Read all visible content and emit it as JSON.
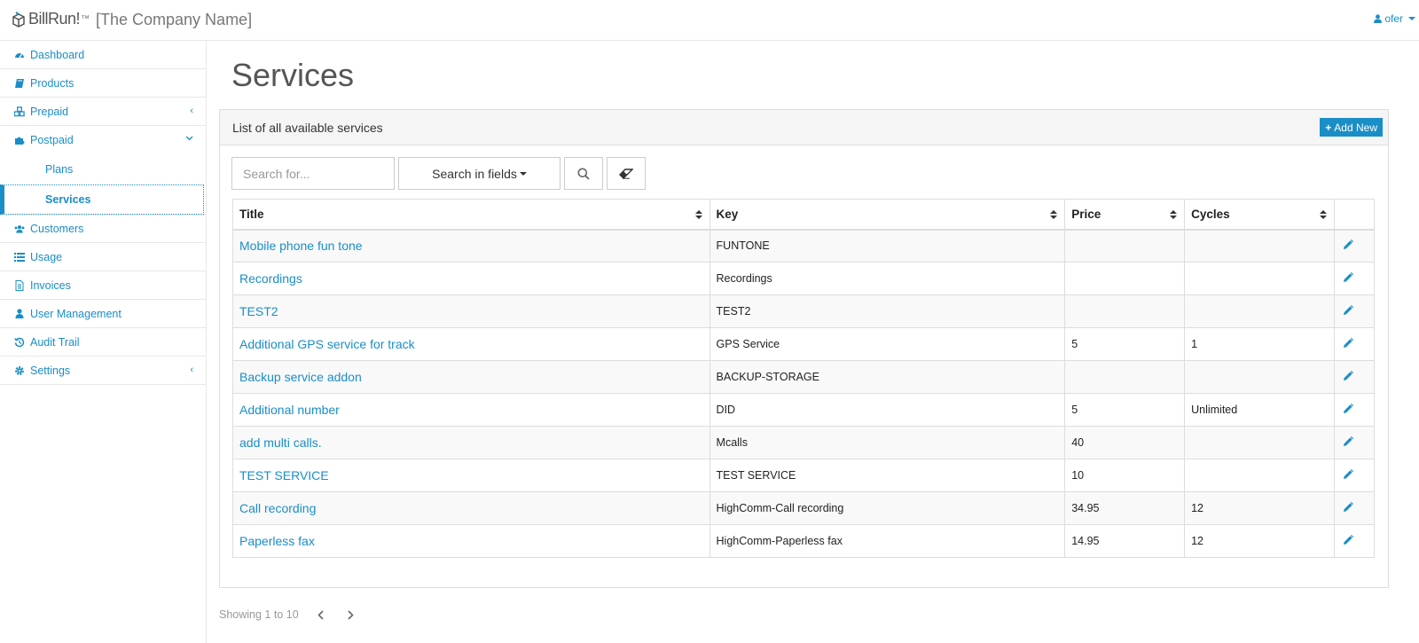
{
  "header": {
    "logo_text": "BillRun!",
    "logo_tm": "™",
    "company": "[The Company Name]",
    "user": "ofer"
  },
  "sidebar": {
    "items": [
      {
        "label": "Dashboard",
        "icon": "dashboard-icon"
      },
      {
        "label": "Products",
        "icon": "book-icon"
      },
      {
        "label": "Prepaid",
        "icon": "cubes-icon",
        "chevron": "‹"
      },
      {
        "label": "Postpaid",
        "icon": "puzzle-icon",
        "chevron": "⌄"
      },
      {
        "label": "Customers",
        "icon": "users-icon"
      },
      {
        "label": "Usage",
        "icon": "list-icon"
      },
      {
        "label": "Invoices",
        "icon": "file-icon"
      },
      {
        "label": "User Management",
        "icon": "user-icon"
      },
      {
        "label": "Audit Trail",
        "icon": "history-icon"
      },
      {
        "label": "Settings",
        "icon": "gear-icon",
        "chevron": "‹"
      }
    ],
    "postpaid_sub": [
      "Plans",
      "Services"
    ]
  },
  "main": {
    "title": "Services",
    "panel_title": "List of all available services",
    "add_new": "Add New",
    "search_placeholder": "Search for...",
    "search_fields": "Search in fields",
    "columns": [
      "Title",
      "Key",
      "Price",
      "Cycles"
    ],
    "rows": [
      {
        "title": "Mobile phone fun tone",
        "key": "FUNTONE",
        "price": "",
        "cycles": ""
      },
      {
        "title": "Recordings",
        "key": "Recordings",
        "price": "",
        "cycles": ""
      },
      {
        "title": "TEST2",
        "key": "TEST2",
        "price": "",
        "cycles": ""
      },
      {
        "title": "Additional GPS service for track",
        "key": "GPS Service",
        "price": "5",
        "cycles": "1"
      },
      {
        "title": "Backup service addon",
        "key": "BACKUP-STORAGE",
        "price": "",
        "cycles": ""
      },
      {
        "title": "Additional number",
        "key": "DID",
        "price": "5",
        "cycles": "Unlimited"
      },
      {
        "title": "add multi calls.",
        "key": "Mcalls",
        "price": "40",
        "cycles": ""
      },
      {
        "title": "TEST SERVICE",
        "key": "TEST SERVICE",
        "price": "10",
        "cycles": ""
      },
      {
        "title": "Call recording",
        "key": "HighComm-Call recording",
        "price": "34.95",
        "cycles": "12"
      },
      {
        "title": "Paperless fax",
        "key": "HighComm-Paperless fax",
        "price": "14.95",
        "cycles": "12"
      }
    ],
    "showing": "Showing 1 to 10"
  },
  "colors": {
    "accent": "#1a8ec6",
    "border": "#dddddd",
    "panel_bg": "#f5f5f5"
  }
}
